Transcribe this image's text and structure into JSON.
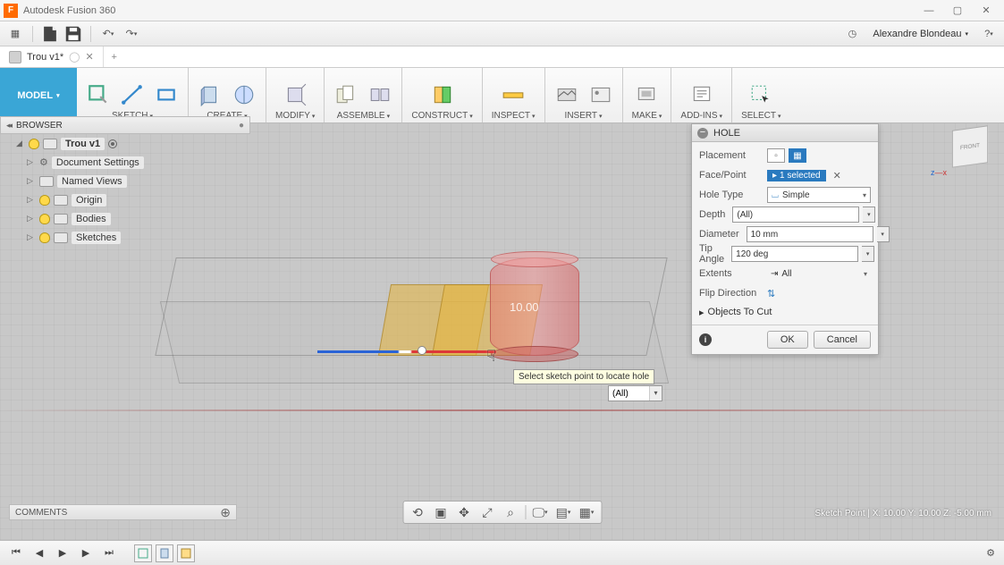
{
  "app": {
    "title": "Autodesk Fusion 360",
    "icon_letter": "F",
    "user": "Alexandre Blondeau"
  },
  "tabs": [
    {
      "label": "Trou v1*"
    }
  ],
  "workspace": "MODEL",
  "toolbar_groups": [
    {
      "label": "SKETCH"
    },
    {
      "label": "CREATE"
    },
    {
      "label": "MODIFY"
    },
    {
      "label": "ASSEMBLE"
    },
    {
      "label": "CONSTRUCT"
    },
    {
      "label": "INSPECT"
    },
    {
      "label": "INSERT"
    },
    {
      "label": "MAKE"
    },
    {
      "label": "ADD-INS"
    },
    {
      "label": "SELECT"
    }
  ],
  "browser": {
    "header": "BROWSER",
    "root": "Trou v1",
    "items": [
      {
        "label": "Document Settings",
        "icon": "gear"
      },
      {
        "label": "Named Views",
        "icon": "folder"
      },
      {
        "label": "Origin",
        "icon": "folder",
        "bulb": true
      },
      {
        "label": "Bodies",
        "icon": "folder",
        "bulb": true
      },
      {
        "label": "Sketches",
        "icon": "folder",
        "bulb": true
      }
    ]
  },
  "hole_panel": {
    "title": "HOLE",
    "placement_label": "Placement",
    "facepoint_label": "Face/Point",
    "facepoint_value": "1 selected",
    "holetype_label": "Hole Type",
    "holetype_value": "Simple",
    "depth_label": "Depth",
    "depth_value": "(All)",
    "diameter_label": "Diameter",
    "diameter_value": "10 mm",
    "tipangle_label": "Tip Angle",
    "tipangle_value": "120 deg",
    "extents_label": "Extents",
    "extents_value": "All",
    "flip_label": "Flip Direction",
    "objects_label": "Objects To Cut",
    "ok": "OK",
    "cancel": "Cancel"
  },
  "canvas": {
    "cylinder_label": "10.00",
    "tooltip": "Select sketch point to locate hole",
    "dim_value": "(All)"
  },
  "comments_label": "COMMENTS",
  "status": "Sketch Point | X: 10.00 Y: 10.00 Z: -5.00 mm",
  "viewcube": {
    "face": "FRONT",
    "axis_x": "x",
    "axis_z": "z"
  }
}
